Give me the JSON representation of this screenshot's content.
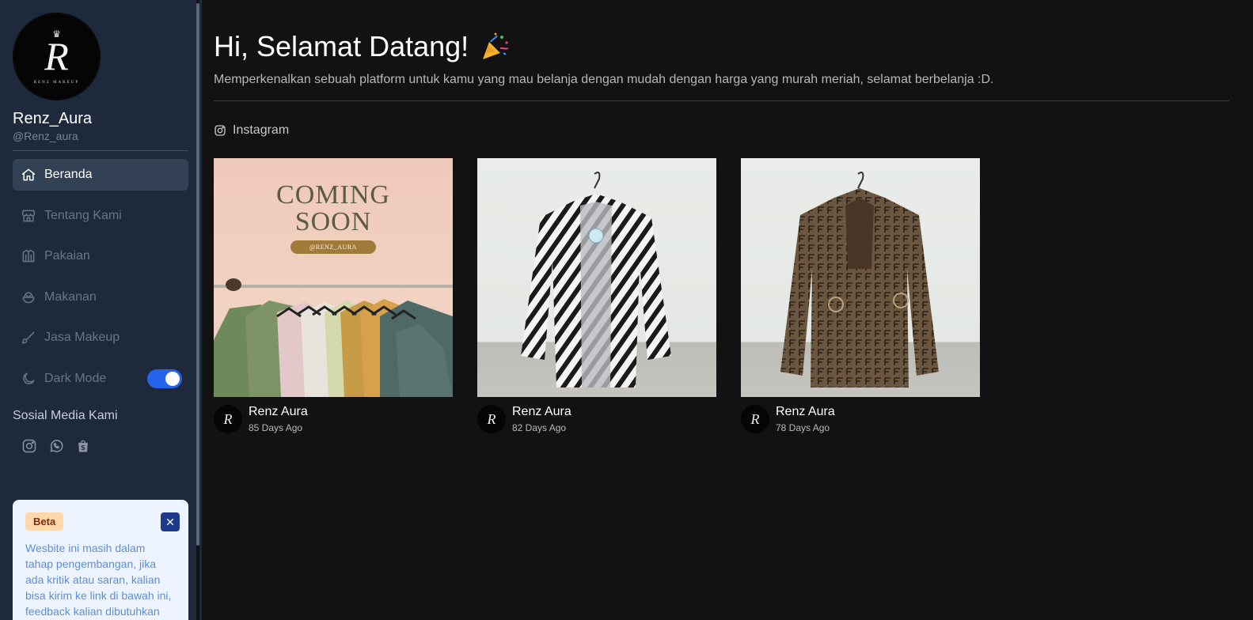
{
  "profile": {
    "name": "Renz_Aura",
    "handle": "@Renz_aura",
    "logo_letter": "R",
    "logo_text": "RENZ MAKEUP"
  },
  "nav": {
    "items": [
      {
        "label": "Beranda",
        "icon": "home-icon",
        "active": true
      },
      {
        "label": "Tentang Kami",
        "icon": "store-icon",
        "active": false
      },
      {
        "label": "Pakaian",
        "icon": "shirt-icon",
        "active": false
      },
      {
        "label": "Makanan",
        "icon": "bowl-icon",
        "active": false
      },
      {
        "label": "Jasa Makeup",
        "icon": "brush-icon",
        "active": false
      }
    ],
    "dark_mode": {
      "label": "Dark Mode",
      "icon": "moon-icon",
      "enabled": true
    }
  },
  "social": {
    "title": "Sosial Media Kami",
    "icons": [
      "instagram-icon",
      "whatsapp-icon",
      "shopee-icon"
    ]
  },
  "beta": {
    "badge": "Beta",
    "text": "Wesbite ini masih dalam tahap pengembangan, jika ada kritik atau saran, kalian bisa kirim ke link di bawah ini, feedback kalian dibutuhkan untuk"
  },
  "header": {
    "title": "Hi, Selamat Datang!",
    "title_icon": "party-popper-icon",
    "subtitle": "Memperkenalkan sebuah platform untuk kamu yang mau belanja dengan mudah dengan harga yang murah meriah, selamat berbelanja :D."
  },
  "source": {
    "label": "Instagram",
    "icon": "instagram-icon"
  },
  "posts": [
    {
      "author": "Renz Aura",
      "ago": "85 Days Ago",
      "image_text": "COMING SOON",
      "image_tag": "@RENZ_AURA"
    },
    {
      "author": "Renz Aura",
      "ago": "82 Days Ago"
    },
    {
      "author": "Renz Aura",
      "ago": "78 Days Ago"
    }
  ],
  "colors": {
    "accent": "#2563eb",
    "sidebar": "#1e293b",
    "background": "#121212"
  }
}
